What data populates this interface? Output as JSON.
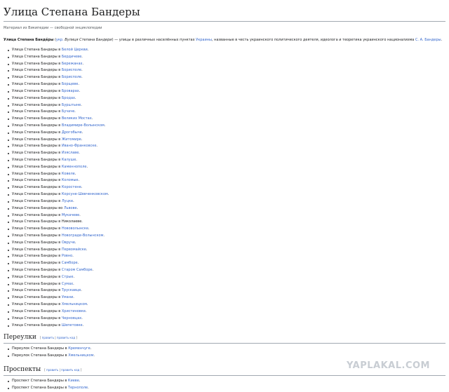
{
  "article": {
    "title": "Улица Степана Бандеры",
    "tagline": "Материал из Википедии — свободной энциклопедии",
    "lead": {
      "bold": "Улица Степана Банде́ры",
      "paren_open": " (",
      "lang_label": "укр.",
      "lang_name": " Вулиця Степана Бандери",
      "paren_close": ") — улицы в различных населённых пунктах ",
      "ukraine_link": "Украины",
      "rest": ", названные в честь украинского политического деятеля, идеолога и теоретика украинского национализма ",
      "bandera_link": "С. А. Бандеры",
      "end": "."
    },
    "street_prefix": "Улица Степана Бандеры",
    "streets": [
      {
        "prep": " в ",
        "city": "Белой Церкви",
        "link": true
      },
      {
        "prep": " в ",
        "city": "Бердичеве",
        "link": true
      },
      {
        "prep": " в ",
        "city": "Бережанах",
        "link": true
      },
      {
        "prep": " в ",
        "city": "Борисполе",
        "link": true
      },
      {
        "prep": " в ",
        "city": "Борисполе",
        "link": true
      },
      {
        "prep": " в ",
        "city": "Борщеве",
        "link": true
      },
      {
        "prep": " в ",
        "city": "Броварах",
        "link": true
      },
      {
        "prep": " в ",
        "city": "Бродах",
        "link": true
      },
      {
        "prep": " в ",
        "city": "Бурштыне",
        "link": true
      },
      {
        "prep": " в ",
        "city": "Бучаче",
        "link": true
      },
      {
        "prep": " в ",
        "city": "Великих Мостах",
        "link": true
      },
      {
        "prep": " в ",
        "city": "Владимире-Волынском",
        "link": true
      },
      {
        "prep": " в ",
        "city": "Дрогобыче",
        "link": true
      },
      {
        "prep": " в ",
        "city": "Житомире",
        "link": true
      },
      {
        "prep": " в ",
        "city": "Ивано-Франковске",
        "link": true
      },
      {
        "prep": " в ",
        "city": "Изяславе",
        "link": true
      },
      {
        "prep": " в ",
        "city": "Калуше",
        "link": true
      },
      {
        "prep": " в ",
        "city": "Каменнополе",
        "link": true
      },
      {
        "prep": " в ",
        "city": "Ковеле",
        "link": true
      },
      {
        "prep": " в ",
        "city": "Коломые",
        "link": true
      },
      {
        "prep": " в ",
        "city": "Коростене",
        "link": true
      },
      {
        "prep": " в ",
        "city": "Корсуне-Шевченковском",
        "link": true
      },
      {
        "prep": " в ",
        "city": "Луцке",
        "link": true
      },
      {
        "prep": " во ",
        "city": "Львове",
        "link": true
      },
      {
        "prep": " в ",
        "city": "Мукачеве",
        "link": true
      },
      {
        "prep": " в ",
        "city": "Николаеве",
        "link": false
      },
      {
        "prep": " в ",
        "city": "Нововолынске",
        "link": true
      },
      {
        "prep": " в ",
        "city": "Новограде-Волынском",
        "link": true
      },
      {
        "prep": " в ",
        "city": "Овруче",
        "link": true
      },
      {
        "prep": " в ",
        "city": "Первомайске",
        "link": true
      },
      {
        "prep": " в ",
        "city": "Ровно",
        "link": true
      },
      {
        "prep": " в ",
        "city": "Самборе",
        "link": true
      },
      {
        "prep": " в ",
        "city": "Старом Самборе",
        "link": true
      },
      {
        "prep": " в ",
        "city": "Стрые",
        "link": true
      },
      {
        "prep": " в ",
        "city": "Сумах",
        "link": true
      },
      {
        "prep": " в ",
        "city": "Трускавце",
        "link": true
      },
      {
        "prep": " в ",
        "city": "Умани",
        "link": true
      },
      {
        "prep": " в ",
        "city": "Хмельницком",
        "link": true
      },
      {
        "prep": " в ",
        "city": "Христиновке",
        "link": true
      },
      {
        "prep": " в ",
        "city": "Черновцах",
        "link": true
      },
      {
        "prep": " в ",
        "city": "Шепетовке",
        "link": true
      }
    ],
    "sections": [
      {
        "title": "Переулки",
        "edit_open": "[ ",
        "edit_link": "править",
        "edit_sep": " | ",
        "edit_code_link": "править код",
        "edit_close": " ]",
        "items": [
          {
            "prefix": "Переулок Степана Бандеры в ",
            "city": "Кременчуге",
            "end": "."
          },
          {
            "prefix": "Переулок Степана Бандеры в ",
            "city": "Хмельницком",
            "end": "."
          }
        ]
      },
      {
        "title": "Проспекты",
        "edit_open": "[ ",
        "edit_link": "править",
        "edit_sep": " | ",
        "edit_code_link": "править код",
        "edit_close": " ]",
        "items": [
          {
            "prefix": "Проспект Степана Бандеры в ",
            "city": "Киеве",
            "end": "."
          },
          {
            "prefix": "Проспект Степана Бандеры в ",
            "city": "Тернополе",
            "end": "."
          }
        ]
      }
    ]
  },
  "watermark": "YAPLAKAL.COM",
  "colors": {
    "link": "#3366cc",
    "text": "#202122",
    "rule": "#a2a9b1"
  }
}
